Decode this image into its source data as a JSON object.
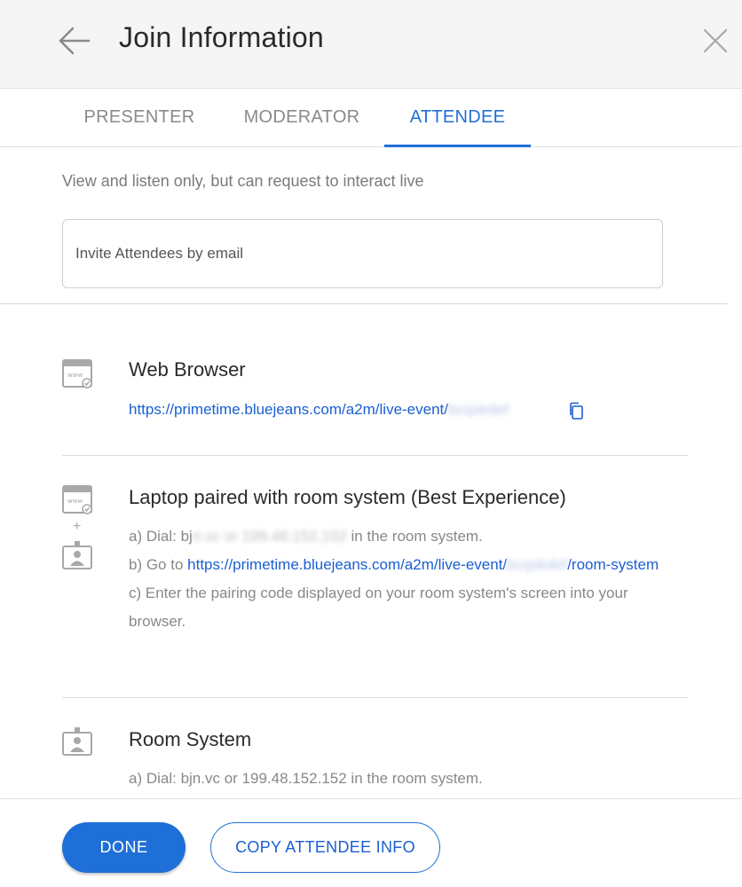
{
  "header": {
    "title": "Join Information",
    "back_icon": "arrow-left-icon",
    "close_icon": "close-icon"
  },
  "tabs": [
    {
      "label": "PRESENTER",
      "active": false
    },
    {
      "label": "MODERATOR",
      "active": false
    },
    {
      "label": "ATTENDEE",
      "active": true
    }
  ],
  "attendee": {
    "description": "View and listen only, but can request to interact live",
    "invite_placeholder": "Invite Attendees by email"
  },
  "web_browser": {
    "title": "Web Browser",
    "link_prefix": "https://primetime.bluejeans.com/a2m/live-event/",
    "link_hidden": "bcqxkdef",
    "icon": "browser-window-icon",
    "copy_icon": "copy-icon"
  },
  "laptop_paired": {
    "title": "Laptop paired with room system (Best Experience)",
    "step_a_prefix": "a) Dial: bj",
    "step_a_hidden1": "n.vc or",
    "step_a_hidden2": "199.48.152.152",
    "step_a_suffix": " in the room system.",
    "step_b_prefix": "b) Go to ",
    "step_b_link_prefix": "https://primetime.bluejeans.com/a2m/live-event/",
    "step_b_link_hidden": "bcqxkdef",
    "step_b_link_suffix": "/room-system",
    "step_c": "c) Enter the pairing code displayed on your room system's screen into your browser.",
    "plus": "+"
  },
  "room_system": {
    "title": "Room System",
    "step_a": "a) Dial: bjn.vc or 199.48.152.152 in the room system."
  },
  "footer": {
    "done_label": "DONE",
    "copy_label": "COPY ATTENDEE INFO"
  },
  "colors": {
    "accent": "#1f6fd8",
    "link": "#1a5fd1",
    "muted_text": "#888888"
  }
}
